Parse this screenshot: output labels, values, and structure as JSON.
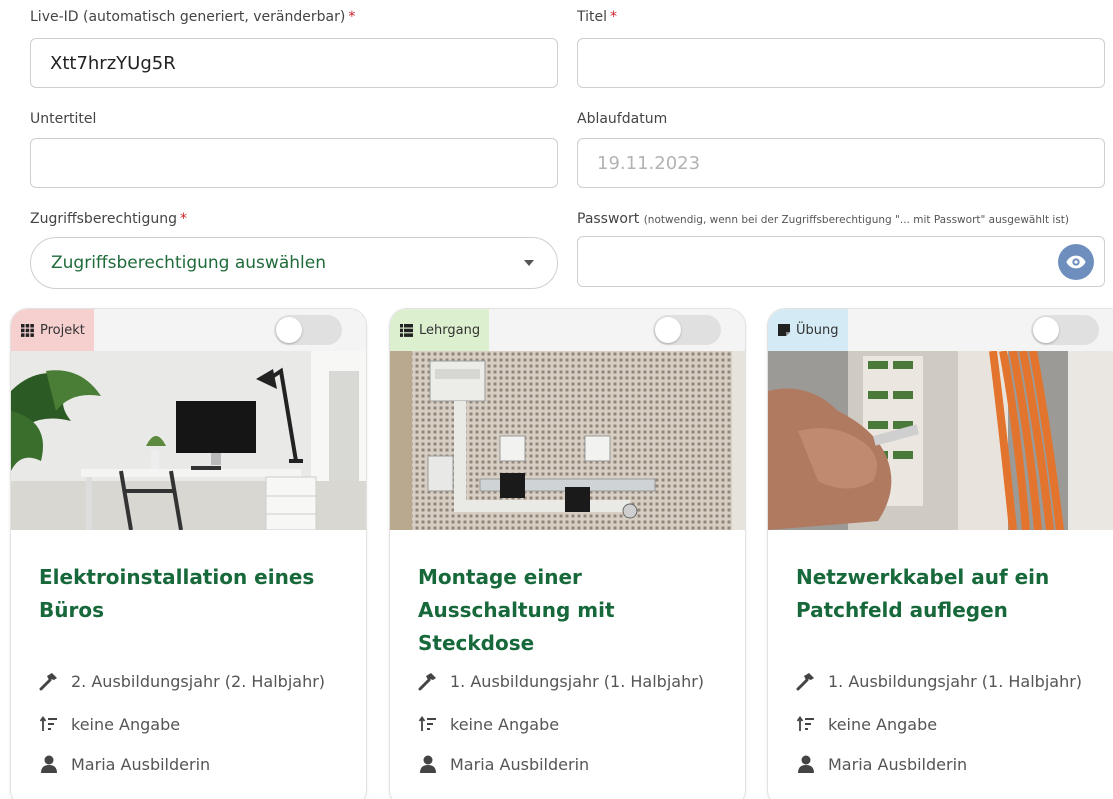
{
  "form": {
    "live_id": {
      "label": "Live-ID (automatisch generiert, veränderbar)",
      "required": "*",
      "value": "Xtt7hrzYUg5R"
    },
    "title": {
      "label": "Titel",
      "required": "*",
      "value": ""
    },
    "subtitle": {
      "label": "Untertitel",
      "value": ""
    },
    "expiry": {
      "label": "Ablaufdatum",
      "placeholder": "19.11.2023"
    },
    "access": {
      "label": "Zugriffsberechtigung",
      "required": "*",
      "selected": "Zugriffsberechtigung auswählen"
    },
    "password": {
      "label": "Passwort",
      "hint": "(notwendig, wenn bei der Zugriffsberechtigung \"... mit Passwort\" ausgewählt ist)",
      "value": ""
    }
  },
  "cards": [
    {
      "type": "Projekt",
      "type_color": "#f6cfcf",
      "type_icon": "grid-icon",
      "enabled": false,
      "title": "Elektroinstallation eines Büros",
      "year": "2. Ausbildungsjahr (2. Halbjahr)",
      "level": "keine Angabe",
      "author": "Maria Ausbilderin"
    },
    {
      "type": "Lehrgang",
      "type_color": "#dcefcf",
      "type_icon": "list-icon",
      "enabled": false,
      "title": "Montage einer Ausschaltung mit Steckdose",
      "year": "1. Ausbildungsjahr (1. Halbjahr)",
      "level": "keine Angabe",
      "author": "Maria Ausbilderin"
    },
    {
      "type": "Übung",
      "type_color": "#d4eaf5",
      "type_icon": "note-icon",
      "enabled": false,
      "title": "Netzwerkkabel auf ein Patchfeld auflegen",
      "year": "1. Ausbildungsjahr (1. Halbjahr)",
      "level": "keine Angabe",
      "author": "Maria Ausbilderin"
    }
  ],
  "colors": {
    "accent_green": "#17683a",
    "required_red": "#d0202a",
    "eye_button": "#6e8fbd"
  }
}
